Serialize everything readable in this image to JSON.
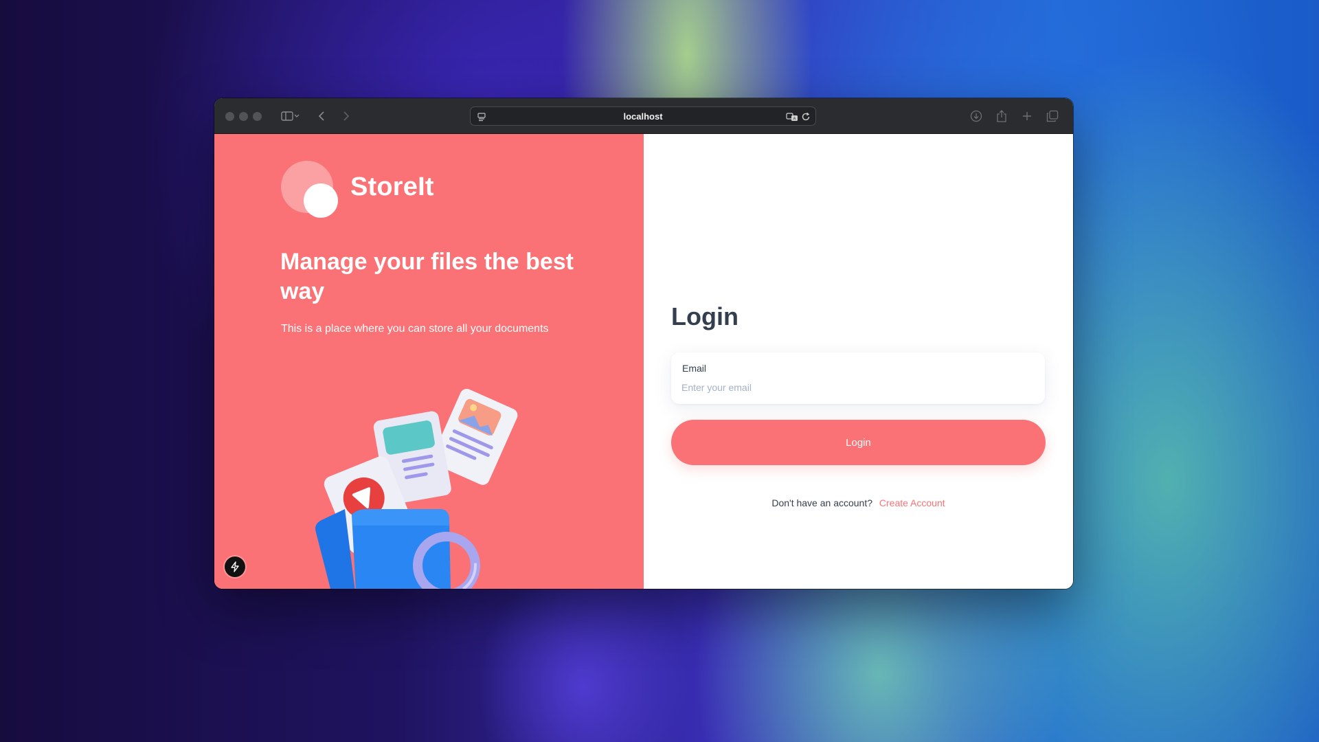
{
  "browser": {
    "address": "localhost",
    "icons": [
      "sidebar-icon",
      "chevron-down-icon",
      "back-arrow-icon",
      "forward-arrow-icon",
      "page-settings-icon",
      "translate-icon",
      "reload-icon",
      "download-icon",
      "share-icon",
      "new-tab-icon",
      "tab-overview-icon"
    ]
  },
  "left_panel": {
    "brand_name": "StoreIt",
    "headline": "Manage your files the best way",
    "subtitle": "This is a place where you can store all your documents",
    "background_color": "#fa7275"
  },
  "login_form": {
    "title": "Login",
    "email_label": "Email",
    "email_placeholder": "Enter your email",
    "email_value": "",
    "submit_label": "Login",
    "signup_prompt": "Don't have an account?",
    "signup_link": "Create Account",
    "accent_color": "#fa7275",
    "text_color": "#333f4e"
  },
  "devtools": {
    "icon": "lightning-icon"
  }
}
